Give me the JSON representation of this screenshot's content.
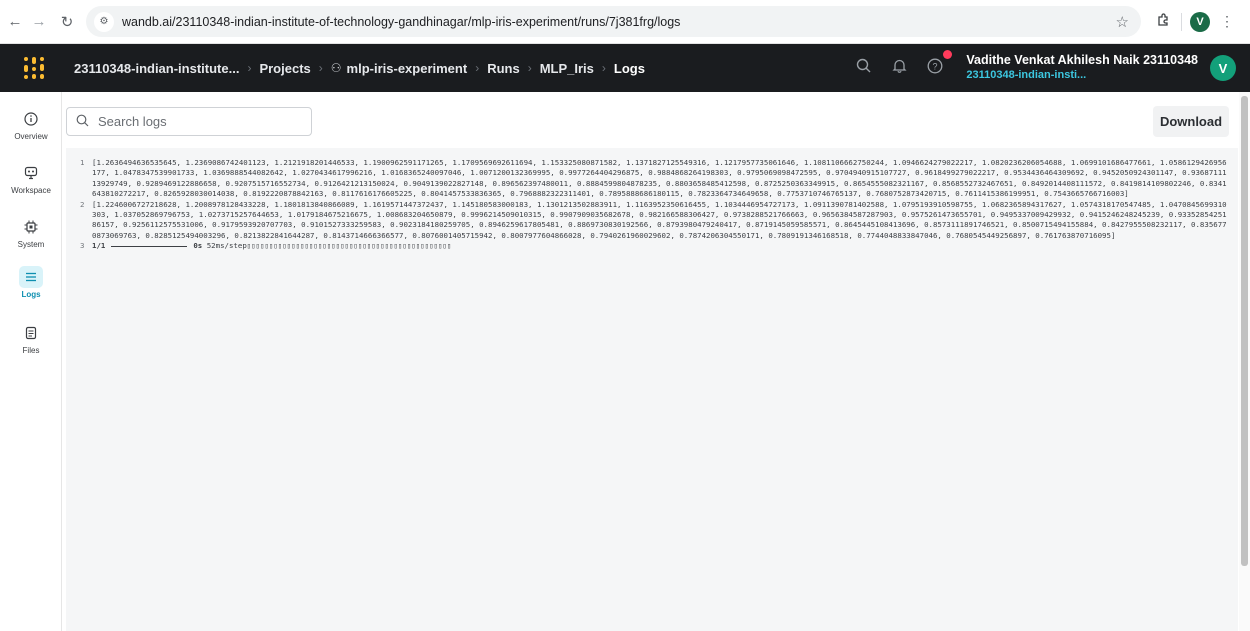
{
  "browser": {
    "url": "wandb.ai/23110348-indian-institute-of-technology-gandhinagar/mlp-iris-experiment/runs/7j381frg/logs",
    "profile_initial": "V"
  },
  "header": {
    "breadcrumbs": {
      "team": "23110348-indian-institute...",
      "projects": "Projects",
      "project": "mlp-iris-experiment",
      "runs": "Runs",
      "run": "MLP_Iris",
      "page": "Logs"
    },
    "user_name": "Vadithe Venkat Akhilesh Naik 23110348",
    "user_team": "23110348-indian-insti...",
    "avatar_initial": "V"
  },
  "left_nav": {
    "overview": "Overview",
    "workspace": "Workspace",
    "system": "System",
    "logs": "Logs",
    "files": "Files"
  },
  "toolbar": {
    "search_placeholder": "Search logs",
    "download_label": "Download"
  },
  "logs": {
    "line1_num": "1",
    "line1": "[1.2636494636535645, 1.2369086742401123, 1.2121918201446533, 1.1900962591171265, 1.1709569692611694, 1.153325080871582, 1.1371827125549316, 1.1217957735061646, 1.1081106662750244, 1.0946624279022217, 1.0820236206054688, 1.0699101686477661, 1.0586129426956177, 1.0478347539901733, 1.0369888544082642, 1.0270434617996216, 1.0168365240097046, 1.0071200132369995, 0.9977264404296875, 0.9884868264198303, 0.9795069098472595, 0.9704940915107727, 0.9618499279022217, 0.9534436464309692, 0.9452050924301147, 0.9368711113929749, 0.9289469122886658, 0.9207515716552734, 0.9126421213150024, 0.9049139022827148, 0.896562397480011, 0.8884599804878235, 0.8803658485412598, 0.8725250363349915, 0.8654555082321167, 0.8568552732467651, 0.8492014408111572, 0.8419814109802246, 0.8341643810272217, 0.8265928030014038, 0.8192220878842163, 0.8117616176605225, 0.8041457533836365, 0.7968882322311401, 0.7895888686180115, 0.7823364734649658, 0.7753710746765137, 0.7680752873420715, 0.7611415386199951, 0.7543665766716003]",
    "line2_num": "2",
    "line2": "[1.2246006727218628, 1.2008978128433228, 1.1801813840866089, 1.1619571447372437, 1.145180583000183, 1.1301213502883911, 1.1163952350616455, 1.1034446954727173, 1.0911390781402588, 1.0795193910598755, 1.0682365894317627, 1.0574318170547485, 1.0470845699310303, 1.037052869796753, 1.0273715257644653, 1.0179184675216675, 1.008683204650879, 0.9996214509010315, 0.9907909035682678, 0.982166588306427, 0.9738288521766663, 0.9656384587287903, 0.9575261473655701, 0.9495337009429932, 0.9415246248245239, 0.9335285425186157, 0.9256112575531006, 0.9179593920707703, 0.9101527333259583, 0.9023184180259705, 0.8946259617805481, 0.8869730830192566, 0.8793980479240417, 0.8719145059585571, 0.8645445108413696, 0.8573111891746521, 0.8500715494155884, 0.8427955508232117, 0.8356770873069763, 0.8285125494003296, 0.8213822841644287, 0.8143714666366577, 0.8076001405715942, 0.8007977604866028, 0.7940261960029602, 0.7874206304550171, 0.7809191346168518, 0.7744048833847046, 0.7680545449256897, 0.761763870716095]",
    "line3_num": "3",
    "line3_step": "1/1",
    "line3_time": "0s",
    "line3_rest": "52ms/step▯▯▯▯▯▯▯▯▯▯▯▯▯▯▯▯▯▯▯▯▯▯▯▯▯▯▯▯▯▯▯▯▯▯▯▯▯▯▯▯▯▯▯▯▯▯"
  },
  "colors": {
    "header_bg": "#1a1c1f",
    "logo_yellow": "#fcbc32",
    "accent_teal": "#0e8fb0",
    "avatar_green": "#13a07a",
    "notification_red": "#ff3b5c"
  }
}
